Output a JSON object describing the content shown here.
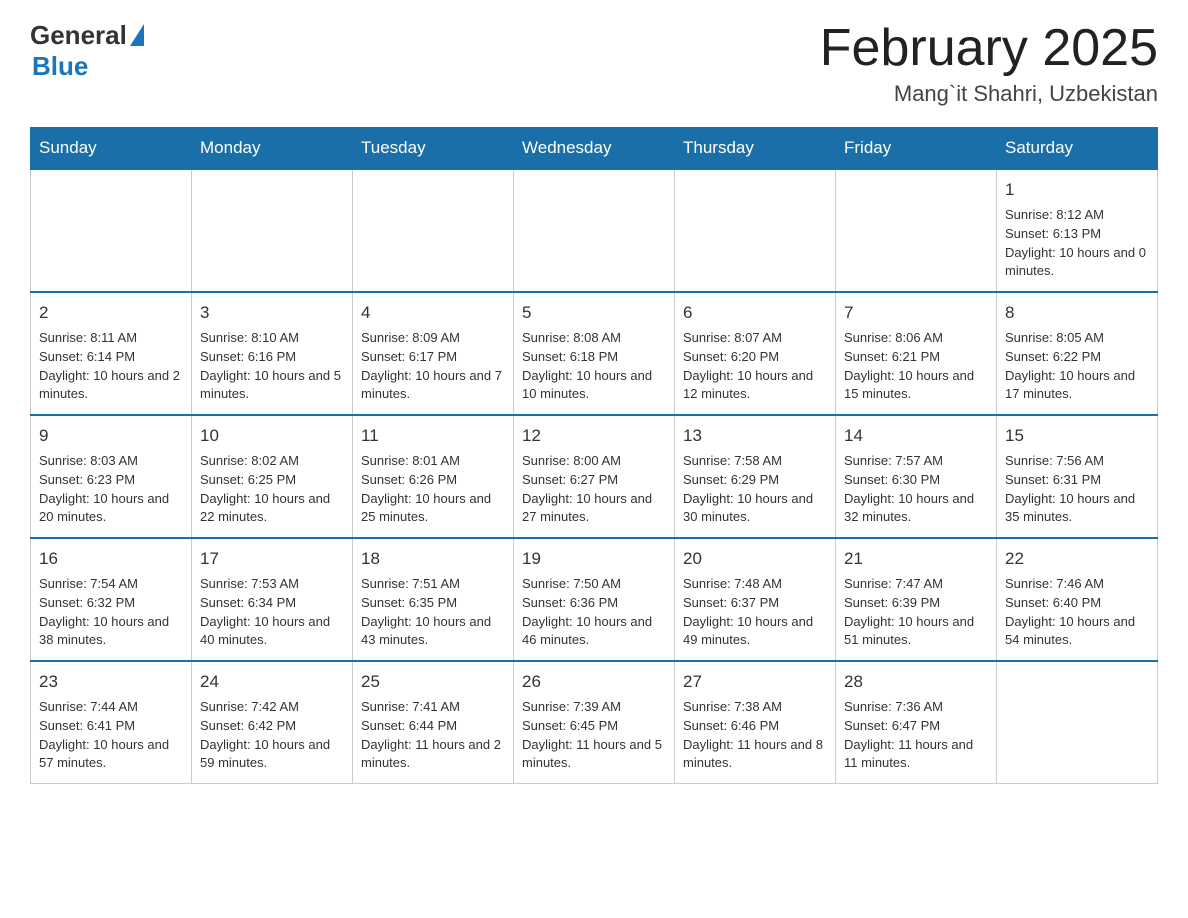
{
  "header": {
    "logo_general": "General",
    "logo_blue": "Blue",
    "month_title": "February 2025",
    "location": "Mang`it Shahri, Uzbekistan"
  },
  "weekdays": [
    "Sunday",
    "Monday",
    "Tuesday",
    "Wednesday",
    "Thursday",
    "Friday",
    "Saturday"
  ],
  "weeks": [
    [
      {
        "day": "",
        "info": ""
      },
      {
        "day": "",
        "info": ""
      },
      {
        "day": "",
        "info": ""
      },
      {
        "day": "",
        "info": ""
      },
      {
        "day": "",
        "info": ""
      },
      {
        "day": "",
        "info": ""
      },
      {
        "day": "1",
        "info": "Sunrise: 8:12 AM\nSunset: 6:13 PM\nDaylight: 10 hours and 0 minutes."
      }
    ],
    [
      {
        "day": "2",
        "info": "Sunrise: 8:11 AM\nSunset: 6:14 PM\nDaylight: 10 hours and 2 minutes."
      },
      {
        "day": "3",
        "info": "Sunrise: 8:10 AM\nSunset: 6:16 PM\nDaylight: 10 hours and 5 minutes."
      },
      {
        "day": "4",
        "info": "Sunrise: 8:09 AM\nSunset: 6:17 PM\nDaylight: 10 hours and 7 minutes."
      },
      {
        "day": "5",
        "info": "Sunrise: 8:08 AM\nSunset: 6:18 PM\nDaylight: 10 hours and 10 minutes."
      },
      {
        "day": "6",
        "info": "Sunrise: 8:07 AM\nSunset: 6:20 PM\nDaylight: 10 hours and 12 minutes."
      },
      {
        "day": "7",
        "info": "Sunrise: 8:06 AM\nSunset: 6:21 PM\nDaylight: 10 hours and 15 minutes."
      },
      {
        "day": "8",
        "info": "Sunrise: 8:05 AM\nSunset: 6:22 PM\nDaylight: 10 hours and 17 minutes."
      }
    ],
    [
      {
        "day": "9",
        "info": "Sunrise: 8:03 AM\nSunset: 6:23 PM\nDaylight: 10 hours and 20 minutes."
      },
      {
        "day": "10",
        "info": "Sunrise: 8:02 AM\nSunset: 6:25 PM\nDaylight: 10 hours and 22 minutes."
      },
      {
        "day": "11",
        "info": "Sunrise: 8:01 AM\nSunset: 6:26 PM\nDaylight: 10 hours and 25 minutes."
      },
      {
        "day": "12",
        "info": "Sunrise: 8:00 AM\nSunset: 6:27 PM\nDaylight: 10 hours and 27 minutes."
      },
      {
        "day": "13",
        "info": "Sunrise: 7:58 AM\nSunset: 6:29 PM\nDaylight: 10 hours and 30 minutes."
      },
      {
        "day": "14",
        "info": "Sunrise: 7:57 AM\nSunset: 6:30 PM\nDaylight: 10 hours and 32 minutes."
      },
      {
        "day": "15",
        "info": "Sunrise: 7:56 AM\nSunset: 6:31 PM\nDaylight: 10 hours and 35 minutes."
      }
    ],
    [
      {
        "day": "16",
        "info": "Sunrise: 7:54 AM\nSunset: 6:32 PM\nDaylight: 10 hours and 38 minutes."
      },
      {
        "day": "17",
        "info": "Sunrise: 7:53 AM\nSunset: 6:34 PM\nDaylight: 10 hours and 40 minutes."
      },
      {
        "day": "18",
        "info": "Sunrise: 7:51 AM\nSunset: 6:35 PM\nDaylight: 10 hours and 43 minutes."
      },
      {
        "day": "19",
        "info": "Sunrise: 7:50 AM\nSunset: 6:36 PM\nDaylight: 10 hours and 46 minutes."
      },
      {
        "day": "20",
        "info": "Sunrise: 7:48 AM\nSunset: 6:37 PM\nDaylight: 10 hours and 49 minutes."
      },
      {
        "day": "21",
        "info": "Sunrise: 7:47 AM\nSunset: 6:39 PM\nDaylight: 10 hours and 51 minutes."
      },
      {
        "day": "22",
        "info": "Sunrise: 7:46 AM\nSunset: 6:40 PM\nDaylight: 10 hours and 54 minutes."
      }
    ],
    [
      {
        "day": "23",
        "info": "Sunrise: 7:44 AM\nSunset: 6:41 PM\nDaylight: 10 hours and 57 minutes."
      },
      {
        "day": "24",
        "info": "Sunrise: 7:42 AM\nSunset: 6:42 PM\nDaylight: 10 hours and 59 minutes."
      },
      {
        "day": "25",
        "info": "Sunrise: 7:41 AM\nSunset: 6:44 PM\nDaylight: 11 hours and 2 minutes."
      },
      {
        "day": "26",
        "info": "Sunrise: 7:39 AM\nSunset: 6:45 PM\nDaylight: 11 hours and 5 minutes."
      },
      {
        "day": "27",
        "info": "Sunrise: 7:38 AM\nSunset: 6:46 PM\nDaylight: 11 hours and 8 minutes."
      },
      {
        "day": "28",
        "info": "Sunrise: 7:36 AM\nSunset: 6:47 PM\nDaylight: 11 hours and 11 minutes."
      },
      {
        "day": "",
        "info": ""
      }
    ]
  ]
}
